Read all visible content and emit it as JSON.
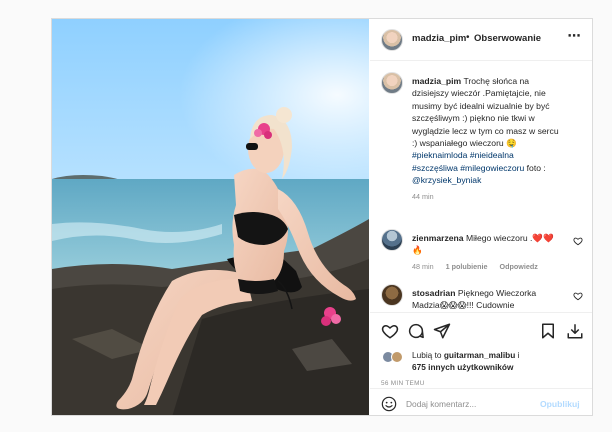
{
  "post": {
    "author": "madzia_pim",
    "dot": "•",
    "follow_label": "Obserwowanie",
    "more_icon": "⋯"
  },
  "caption": {
    "username": "madzia_pim",
    "text": "Trochę słońca na dzisiejszy wieczór .Pamiętajcie, nie musimy być idealni wizualnie by być szczęśliwym :) piękno nie tkwi w wyglądzie lecz w tym co masz w sercu :) wspaniałego wieczoru 🤤",
    "tags": [
      "#pieknaimloda",
      "#nieidealna",
      "#szczęśliwa",
      "#milegowieczoru"
    ],
    "photo_label": "foto :",
    "photo_credit": "@krzysiek_byniak",
    "time": "44 min"
  },
  "comments": [
    {
      "username": "zienmarzena",
      "text": "Miłego wieczoru .❤️❤️🔥",
      "time": "48 min",
      "likes": "1 polubienie",
      "reply": "Odpowiedz"
    },
    {
      "username": "stosadrian",
      "text": "Pięknego Wieczorka Madzia😱😱😱!!! Cudownie",
      "time": "",
      "likes": "",
      "reply": ""
    }
  ],
  "likes": {
    "prefix": "Lubią to",
    "user": "guitarman_malibu",
    "suffix": "i",
    "others": "675 innych użytkowników"
  },
  "timestamp": "56 MIN TEMU",
  "comment_input": {
    "placeholder": "Dodaj komentarz...",
    "publish_label": "Opublikuj"
  },
  "colors": {
    "link": "#00376b",
    "heart": "#ed4956",
    "publish_disabled": "#b3dbff",
    "muted": "#8e8e8e"
  },
  "icons": [
    "more-icon",
    "heart-icon",
    "comment-icon",
    "share-icon",
    "bookmark-icon",
    "download-icon",
    "emoji-icon"
  ]
}
